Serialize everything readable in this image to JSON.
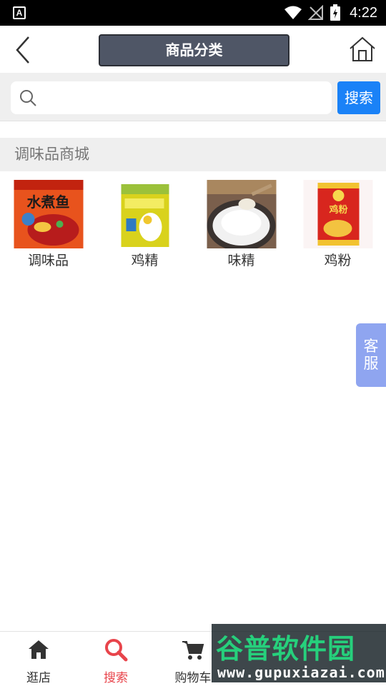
{
  "status_bar": {
    "app_icon_letter": "A",
    "time": "4:22"
  },
  "navbar": {
    "title": "商品分类",
    "back_icon": "chevron-left-icon",
    "home_icon": "home-icon"
  },
  "search": {
    "placeholder": "",
    "value": "",
    "button_label": "搜索"
  },
  "section": {
    "title": "调味品商城"
  },
  "categories": [
    {
      "label": "调味品",
      "image": "spice-package-image"
    },
    {
      "label": "鸡精",
      "image": "chicken-essence-bag-image"
    },
    {
      "label": "味精",
      "image": "msg-spoon-image"
    },
    {
      "label": "鸡粉",
      "image": "chicken-powder-can-image"
    }
  ],
  "thumb_texts": {
    "spice_pack": "水煮鱼",
    "chicken_can": "鸡粉"
  },
  "customer_service": {
    "label_line1": "客",
    "label_line2": "服"
  },
  "tabbar": {
    "tabs": [
      {
        "label": "逛店",
        "icon": "home-icon"
      },
      {
        "label": "搜索",
        "icon": "search-icon",
        "active": true
      },
      {
        "label": "购物车",
        "icon": "cart-icon"
      }
    ]
  },
  "watermark": {
    "title": "谷普软件园",
    "url": "www.gupuxiazai.com"
  },
  "colors": {
    "accent_blue": "#1a82f7",
    "title_bg": "#4f5666",
    "active_tab": "#e8444b",
    "cs_button": "#8fa5f0"
  }
}
